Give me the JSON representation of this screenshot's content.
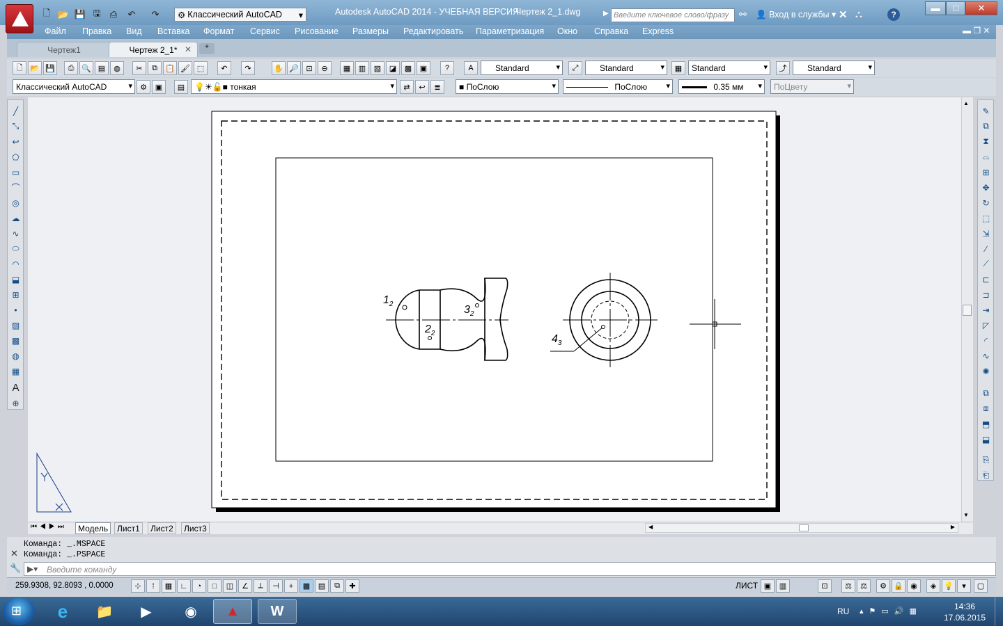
{
  "window": {
    "title": "Autodesk AutoCAD 2014 - УЧЕБНАЯ ВЕРСИЯ",
    "filename": "Чертеж 2_1.dwg",
    "workspace": "Классический AutoCAD",
    "search_placeholder": "Введите ключевое слово/фразу",
    "login": "Вход в службы",
    "help": "?",
    "minimize": "▬",
    "maximize": "□",
    "close": "✕"
  },
  "menu": {
    "items": [
      "Файл",
      "Правка",
      "Вид",
      "Вставка",
      "Формат",
      "Сервис",
      "Рисование",
      "Размеры",
      "Редактировать",
      "Параметризация",
      "Окно",
      "Справка",
      "Express"
    ]
  },
  "file_tabs": [
    {
      "label": "Чертеж1",
      "active": false
    },
    {
      "label": "Чертеж 2_1*",
      "active": true
    }
  ],
  "toolbar_styles": {
    "text_style": "Standard",
    "dim_style": "Standard",
    "table_style": "Standard",
    "mleader_style": "Standard"
  },
  "properties_toolbar": {
    "workspace": "Классический AutoCAD",
    "layer": "тонкая",
    "color": "ПоСлою",
    "linetype": "ПоСлою",
    "lineweight": "0.35 мм",
    "plotstyle": "ПоЦвету"
  },
  "drawing_labels": {
    "p1": "1",
    "p1_sub": "2",
    "p2": "2",
    "p2_sub": "2",
    "p3": "3",
    "p3_sub": "2",
    "p4": "4",
    "p4_sub": "3"
  },
  "layout_tabs": [
    "Модель",
    "Лист1",
    "Лист2",
    "Лист3"
  ],
  "command": {
    "history": [
      "Команда:  _.MSPACE",
      "Команда:  _.PSPACE"
    ],
    "placeholder": "Введите команду"
  },
  "status": {
    "coordinates": "259.9308, 92.8093 , 0.0000",
    "space": "ЛИСТ"
  },
  "taskbar": {
    "language": "RU",
    "time": "14:36",
    "date": "17.06.2015"
  },
  "colors": {
    "titlebar": "#7aa5ca",
    "app_button": "#c9252b",
    "canvas_bg": "#eef0f3"
  }
}
